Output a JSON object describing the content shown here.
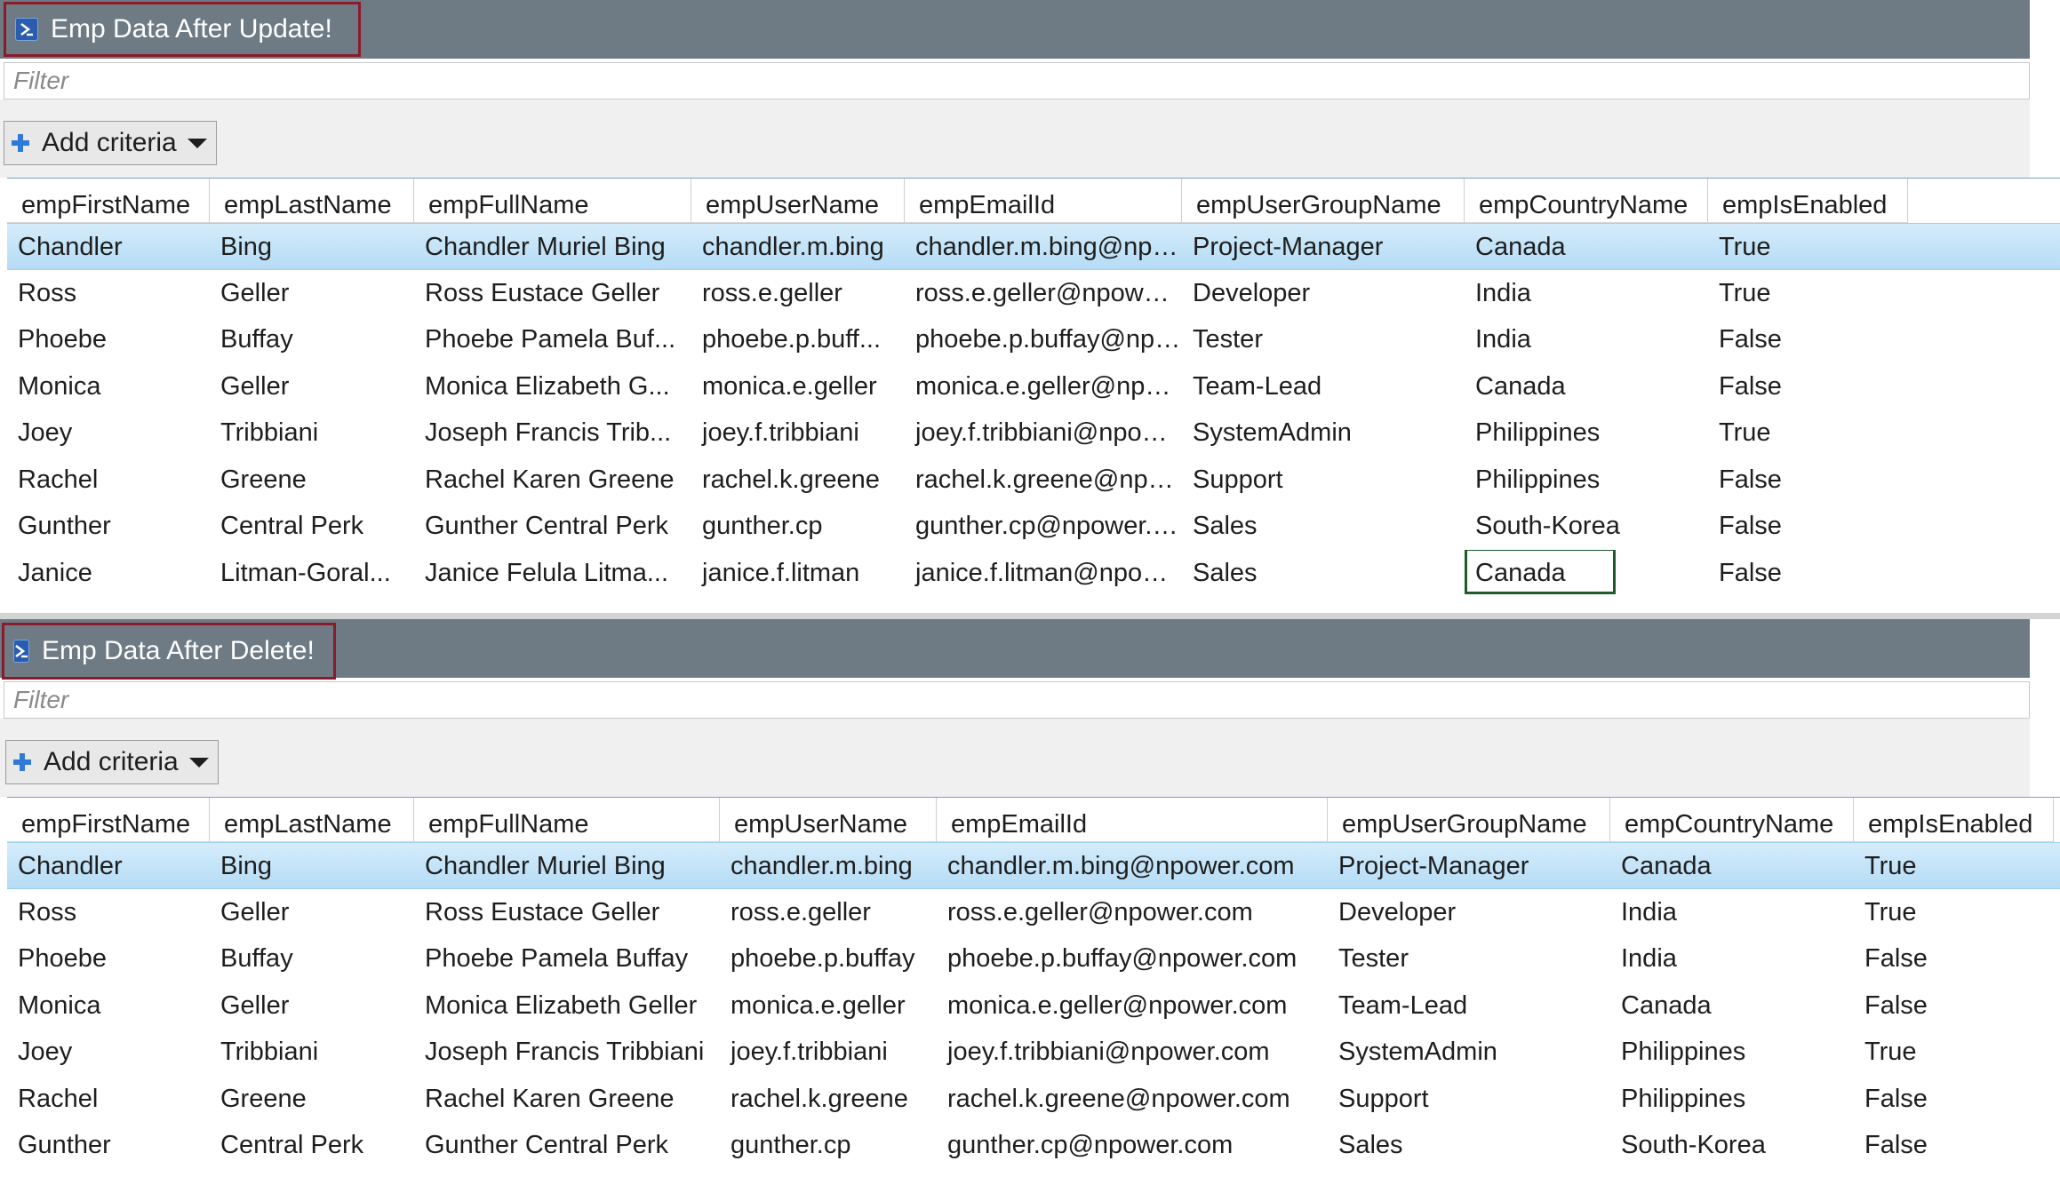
{
  "colors": {
    "titlebar": "#6e7b84",
    "title_border": "#8b1a2b",
    "selected_row": "#c3e3f8",
    "focus_cell_border": "#1f5a2c",
    "add_icon": "#2f7ad8"
  },
  "columns": [
    "empFirstName",
    "empLastName",
    "empFullName",
    "empUserName",
    "empEmailId",
    "empUserGroupName",
    "empCountryName",
    "empIsEnabled"
  ],
  "panels": [
    {
      "title": "Emp Data After Update!",
      "icon": "powershell-icon",
      "filter_placeholder": "Filter",
      "add_criteria_label": "Add criteria",
      "selected_row": 0,
      "focused_cell": {
        "row": 7,
        "col": 6
      },
      "rows": [
        [
          "Chandler",
          "Bing",
          "Chandler Muriel Bing",
          "chandler.m.bing",
          "chandler.m.bing@npower.com",
          "Project-Manager",
          "Canada",
          "True"
        ],
        [
          "Ross",
          "Geller",
          "Ross Eustace Geller",
          "ross.e.geller",
          "ross.e.geller@npower.com",
          "Developer",
          "India",
          "True"
        ],
        [
          "Phoebe",
          "Buffay",
          "Phoebe Pamela Buf...",
          "phoebe.p.buff...",
          "phoebe.p.buffay@npower.co...",
          "Tester",
          "India",
          "False"
        ],
        [
          "Monica",
          "Geller",
          "Monica Elizabeth G...",
          "monica.e.geller",
          "monica.e.geller@npower.com",
          "Team-Lead",
          "Canada",
          "False"
        ],
        [
          "Joey",
          "Tribbiani",
          "Joseph Francis Trib...",
          "joey.f.tribbiani",
          "joey.f.tribbiani@npower.com",
          "SystemAdmin",
          "Philippines",
          "True"
        ],
        [
          "Rachel",
          "Greene",
          "Rachel Karen Greene",
          "rachel.k.greene",
          "rachel.k.greene@npower.com",
          "Support",
          "Philippines",
          "False"
        ],
        [
          "Gunther",
          "Central Perk",
          "Gunther Central Perk",
          "gunther.cp",
          "gunther.cp@npower.com",
          "Sales",
          "South-Korea",
          "False"
        ],
        [
          "Janice",
          "Litman-Goral...",
          "Janice Felula Litma...",
          "janice.f.litman",
          "janice.f.litman@npower.com",
          "Sales",
          "Canada",
          "False"
        ]
      ]
    },
    {
      "title": "Emp Data After Delete!",
      "icon": "powershell-icon",
      "filter_placeholder": "Filter",
      "add_criteria_label": "Add criteria",
      "selected_row": 0,
      "rows": [
        [
          "Chandler",
          "Bing",
          "Chandler Muriel Bing",
          "chandler.m.bing",
          "chandler.m.bing@npower.com",
          "Project-Manager",
          "Canada",
          "True"
        ],
        [
          "Ross",
          "Geller",
          "Ross Eustace Geller",
          "ross.e.geller",
          "ross.e.geller@npower.com",
          "Developer",
          "India",
          "True"
        ],
        [
          "Phoebe",
          "Buffay",
          "Phoebe Pamela Buffay",
          "phoebe.p.buffay",
          "phoebe.p.buffay@npower.com",
          "Tester",
          "India",
          "False"
        ],
        [
          "Monica",
          "Geller",
          "Monica Elizabeth Geller",
          "monica.e.geller",
          "monica.e.geller@npower.com",
          "Team-Lead",
          "Canada",
          "False"
        ],
        [
          "Joey",
          "Tribbiani",
          "Joseph Francis Tribbiani",
          "joey.f.tribbiani",
          "joey.f.tribbiani@npower.com",
          "SystemAdmin",
          "Philippines",
          "True"
        ],
        [
          "Rachel",
          "Greene",
          "Rachel Karen Greene",
          "rachel.k.greene",
          "rachel.k.greene@npower.com",
          "Support",
          "Philippines",
          "False"
        ],
        [
          "Gunther",
          "Central Perk",
          "Gunther Central Perk",
          "gunther.cp",
          "gunther.cp@npower.com",
          "Sales",
          "South-Korea",
          "False"
        ]
      ]
    }
  ]
}
